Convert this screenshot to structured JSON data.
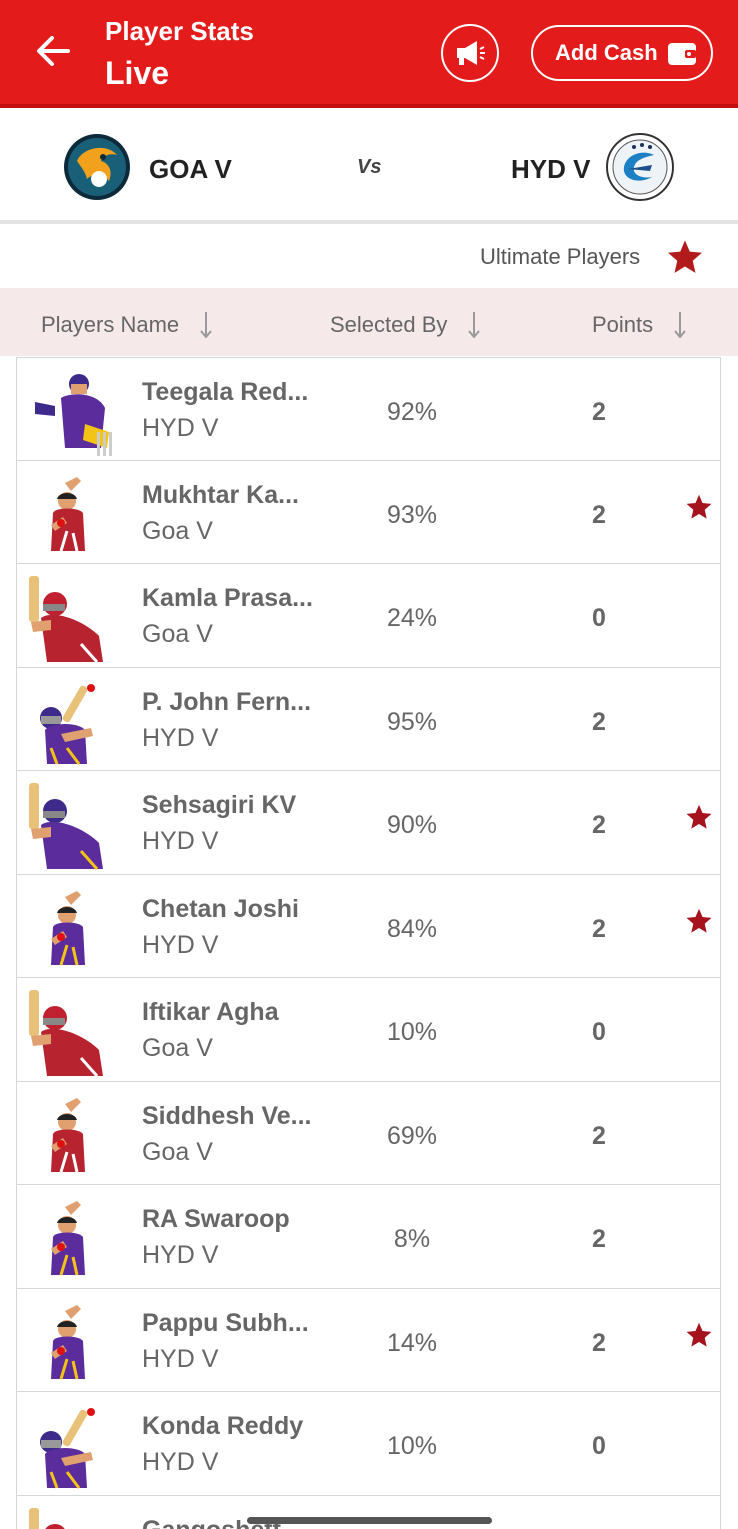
{
  "header": {
    "title": "Player Stats",
    "subtitle": "Live",
    "add_cash_label": "Add Cash",
    "bg_color": "#e31b1b"
  },
  "match": {
    "team_left": "GOA V",
    "vs_label": "Vs",
    "team_right": "HYD V"
  },
  "ultimate_label": "Ultimate Players",
  "columns": {
    "name": "Players Name",
    "selected": "Selected By",
    "points": "Points"
  },
  "players": [
    {
      "name": "Teegala Red...",
      "team": "HYD V",
      "selected": "92%",
      "points": "2",
      "ultimate": false,
      "kit": "hyd",
      "pose": "keeper"
    },
    {
      "name": "Mukhtar Ka...",
      "team": "Goa V",
      "selected": "93%",
      "points": "2",
      "ultimate": true,
      "kit": "goa",
      "pose": "bowler"
    },
    {
      "name": "Kamla Prasa...",
      "team": "Goa V",
      "selected": "24%",
      "points": "0",
      "ultimate": false,
      "kit": "goa",
      "pose": "batsman"
    },
    {
      "name": "P. John Fern...",
      "team": "HYD V",
      "selected": "95%",
      "points": "2",
      "ultimate": false,
      "kit": "hyd",
      "pose": "allrounder"
    },
    {
      "name": "Sehsagiri KV",
      "team": "HYD V",
      "selected": "90%",
      "points": "2",
      "ultimate": true,
      "kit": "hyd",
      "pose": "batsman"
    },
    {
      "name": "Chetan Joshi",
      "team": "HYD V",
      "selected": "84%",
      "points": "2",
      "ultimate": true,
      "kit": "hyd",
      "pose": "bowler"
    },
    {
      "name": "Iftikar Agha",
      "team": "Goa V",
      "selected": "10%",
      "points": "0",
      "ultimate": false,
      "kit": "goa",
      "pose": "batsman"
    },
    {
      "name": "Siddhesh Ve...",
      "team": "Goa V",
      "selected": "69%",
      "points": "2",
      "ultimate": false,
      "kit": "goa",
      "pose": "bowler"
    },
    {
      "name": "RA Swaroop",
      "team": "HYD V",
      "selected": "8%",
      "points": "2",
      "ultimate": false,
      "kit": "hyd",
      "pose": "bowler"
    },
    {
      "name": "Pappu Subh...",
      "team": "HYD V",
      "selected": "14%",
      "points": "2",
      "ultimate": true,
      "kit": "hyd",
      "pose": "bowler"
    },
    {
      "name": "Konda Reddy",
      "team": "HYD V",
      "selected": "10%",
      "points": "0",
      "ultimate": false,
      "kit": "hyd",
      "pose": "allrounder"
    },
    {
      "name": "Gangoshett...",
      "team": "",
      "selected": "",
      "points": "",
      "ultimate": false,
      "kit": "goa",
      "pose": "batsman"
    }
  ]
}
